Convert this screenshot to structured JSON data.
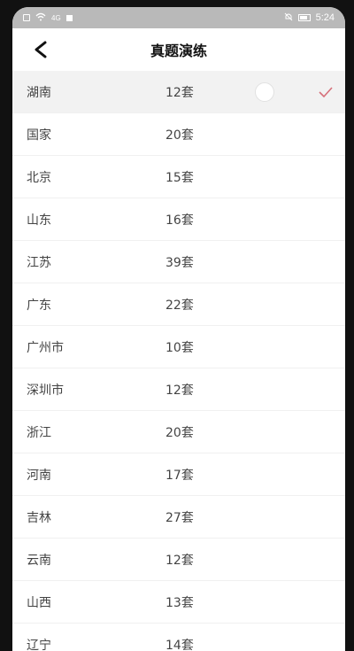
{
  "statusbar": {
    "time": "5:24",
    "signal_text": "4G"
  },
  "header": {
    "title": "真题演练"
  },
  "list": {
    "items": [
      {
        "name": "湖南",
        "count": "12套",
        "selected": true
      },
      {
        "name": "国家",
        "count": "20套"
      },
      {
        "name": "北京",
        "count": "15套"
      },
      {
        "name": "山东",
        "count": "16套"
      },
      {
        "name": "江苏",
        "count": "39套"
      },
      {
        "name": "广东",
        "count": "22套"
      },
      {
        "name": "广州市",
        "count": "10套"
      },
      {
        "name": "深圳市",
        "count": "12套"
      },
      {
        "name": "浙江",
        "count": "20套"
      },
      {
        "name": "河南",
        "count": "17套"
      },
      {
        "name": "吉林",
        "count": "27套"
      },
      {
        "name": "云南",
        "count": "12套"
      },
      {
        "name": "山西",
        "count": "13套"
      },
      {
        "name": "辽宁",
        "count": "14套"
      }
    ]
  },
  "colors": {
    "accent": "#d6707a",
    "selected_bg": "#f2f2f2"
  }
}
